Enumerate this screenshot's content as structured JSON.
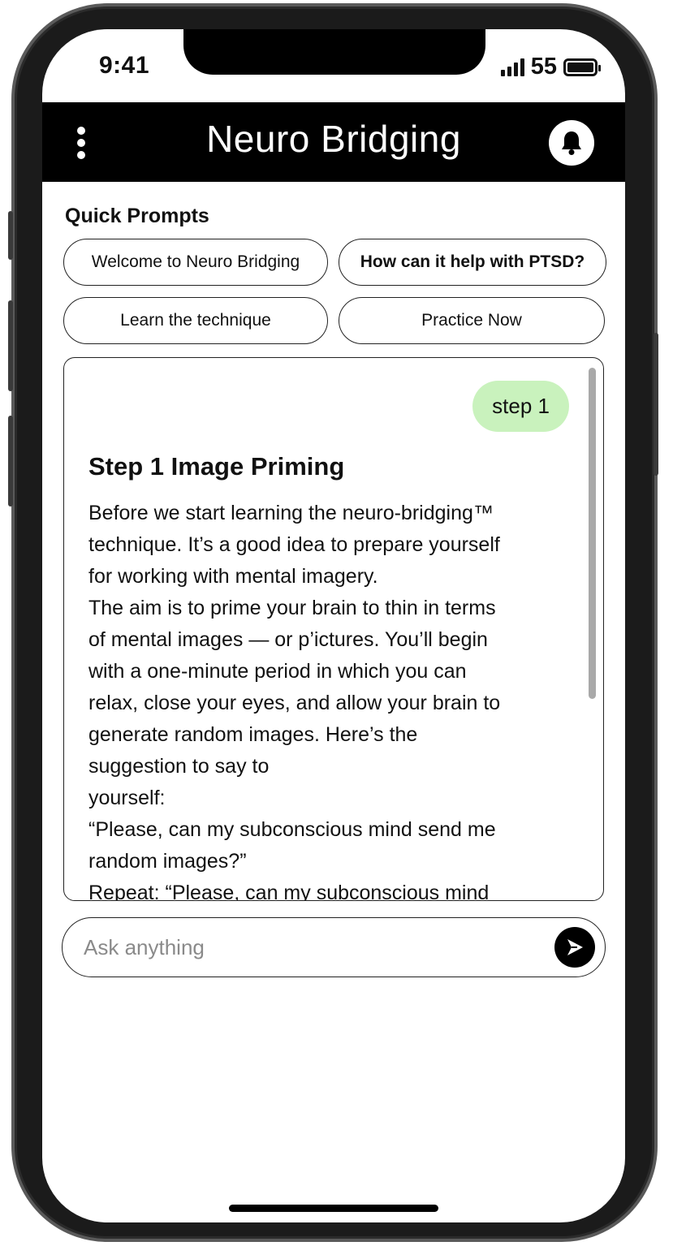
{
  "status_bar": {
    "time": "9:41",
    "battery": "55"
  },
  "header": {
    "title": "Neuro Bridging",
    "menu_icon": "more-vertical-icon",
    "bell_icon": "bell-icon"
  },
  "quick_prompts": {
    "heading": "Quick Prompts",
    "items": [
      {
        "label": "Welcome to Neuro Bridging"
      },
      {
        "label": "How can it help with PTSD?"
      },
      {
        "label": "Learn the technique"
      },
      {
        "label": "Practice Now"
      }
    ]
  },
  "chat": {
    "user_message": "step 1",
    "response_title": "Step 1 Image Priming",
    "response_lines": [
      "Before we start learning the neuro-bridging™",
      "technique. It’s a good idea to prepare yourself",
      "for working with mental imagery.",
      "The aim is to prime your brain to thin in terms",
      "of mental images — or p’ictures. You’ll begin",
      "with a one-minute period in which you can",
      "relax, close your eyes, and allow your brain to",
      "generate random images. Here’s the",
      "suggestion to say to",
      "yourself:",
      "“Please, can my subconscious mind send me",
      "random images?”",
      "Repeat: “Please,  can my subconscious mind"
    ]
  },
  "composer": {
    "placeholder": "Ask anything",
    "send_icon": "send-icon"
  },
  "colors": {
    "header_bg": "#000000",
    "user_bubble": "#c9f2bd",
    "scrollbar": "#a9a9a9"
  }
}
